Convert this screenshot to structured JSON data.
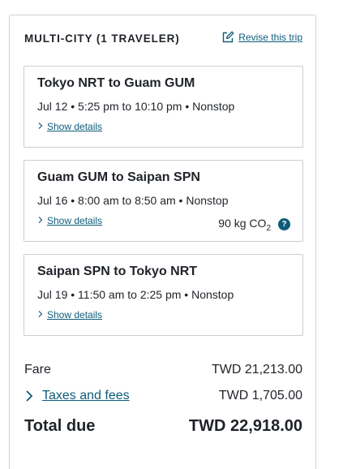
{
  "header": {
    "title": "MULTI-CITY (1 TRAVELER)",
    "revise_label": "Revise this trip"
  },
  "flights": [
    {
      "route": "Tokyo NRT to Guam GUM",
      "info": "Jul 12 • 5:25 pm to 10:10 pm • Nonstop",
      "details_label": "Show details"
    },
    {
      "route": "Guam GUM to Saipan SPN",
      "info": "Jul 16 • 8:00 am to 8:50 am • Nonstop",
      "details_label": "Show details",
      "co2_value": "90 kg CO",
      "co2_sub": "2",
      "help_label": "?"
    },
    {
      "route": "Saipan SPN to Tokyo NRT",
      "info": "Jul 19 • 11:50 am to 2:25 pm • Nonstop",
      "details_label": "Show details"
    }
  ],
  "summary": {
    "fare_label": "Fare",
    "fare_value": "TWD 21,213.00",
    "taxes_label": "Taxes and fees",
    "taxes_value": "TWD 1,705.00",
    "total_label": "Total due",
    "total_value": "TWD 22,918.00"
  },
  "colors": {
    "link": "#0d5b7a",
    "text": "#1f2329",
    "border": "#c9ced4"
  },
  "icons": {
    "revise": "edit-icon",
    "chevron": "chevron-right-icon",
    "help": "help-icon"
  }
}
